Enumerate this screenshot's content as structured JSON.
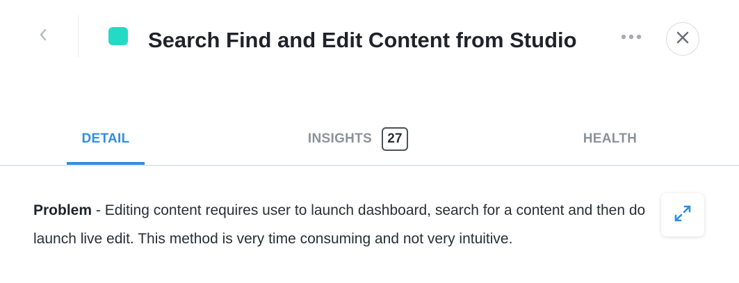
{
  "header": {
    "title": "Search Find and Edit Content from Studio",
    "swatch_color": "#23dbc4",
    "back_icon": "chevron-left-icon",
    "more_icon": "more-horizontal-icon",
    "close_icon": "close-icon"
  },
  "tabs": [
    {
      "label": "DETAIL",
      "active": true
    },
    {
      "label": "INSIGHTS",
      "count": "27",
      "active": false
    },
    {
      "label": "HEALTH",
      "active": false
    }
  ],
  "description": {
    "label": "Problem",
    "separator": " - ",
    "text": "Editing content requires user to launch dashboard, search for a content and then do launch live edit. This method is very time consuming and not very intuitive."
  },
  "expand_icon": "expand-icon",
  "colors": {
    "accent": "#2f8de4",
    "swatch": "#23dbc4"
  }
}
